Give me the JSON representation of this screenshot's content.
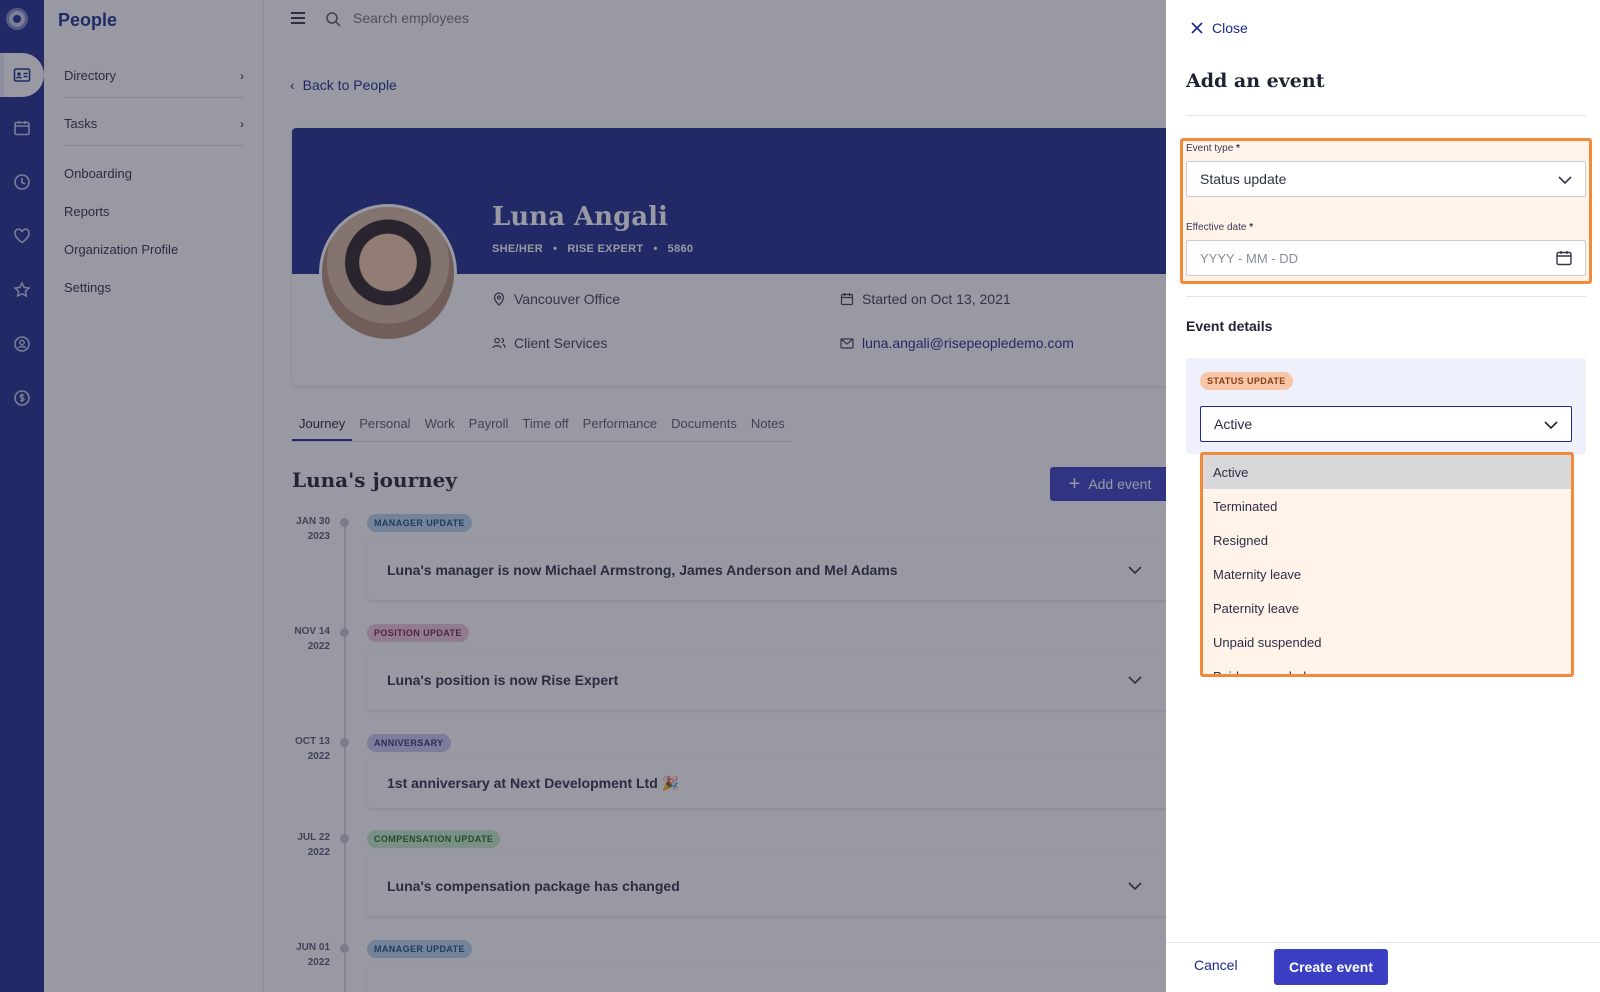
{
  "app": {
    "section_title": "People"
  },
  "sidebar": {
    "items": [
      {
        "label": "Directory"
      },
      {
        "label": "Tasks"
      },
      {
        "label": "Onboarding"
      },
      {
        "label": "Reports"
      },
      {
        "label": "Organization Profile"
      },
      {
        "label": "Settings"
      }
    ]
  },
  "search": {
    "placeholder": "Search employees"
  },
  "back_link": "Back to People",
  "profile": {
    "name": "Luna Angali",
    "pronouns": "SHE/HER",
    "role": "RISE EXPERT",
    "employee_id": "5860",
    "sep": "•",
    "office": "Vancouver Office",
    "team": "Client Services",
    "started": "Started on Oct 13, 2021",
    "email": "luna.angali@risepeopledemo.com"
  },
  "tabs": [
    "Journey",
    "Personal",
    "Work",
    "Payroll",
    "Time off",
    "Performance",
    "Documents",
    "Notes"
  ],
  "journey": {
    "title": "Luna's journey",
    "add_event_label": "Add event",
    "events": [
      {
        "month_day": "JAN 30",
        "year": "2023",
        "badge": "MANAGER UPDATE",
        "badge_color": "#b9d5f0",
        "badge_text_color": "#1f4c7a",
        "text": "Luna's manager is now Michael Armstrong, James Anderson and Mel Adams"
      },
      {
        "month_day": "NOV 14",
        "year": "2022",
        "badge": "POSITION UPDATE",
        "badge_color": "#f0c6dc",
        "badge_text_color": "#7a1f4c",
        "text": "Luna's position is now Rise Expert"
      },
      {
        "month_day": "OCT 13",
        "year": "2022",
        "badge": "ANNIVERSARY",
        "badge_color": "#c9c9f2",
        "badge_text_color": "#2e2e7a",
        "text": "1st anniversary at Next Development Ltd 🎉"
      },
      {
        "month_day": "JUL 22",
        "year": "2022",
        "badge": "COMPENSATION UPDATE",
        "badge_color": "#c6ecc9",
        "badge_text_color": "#1f6a28",
        "text": "Luna's compensation package has changed"
      },
      {
        "month_day": "JUN 01",
        "year": "2022",
        "badge": "MANAGER UPDATE",
        "badge_color": "#b9d5f0",
        "badge_text_color": "#1f4c7a",
        "text": ""
      }
    ]
  },
  "drawer": {
    "close_label": "Close",
    "title": "Add an event",
    "event_type_label": "Event type",
    "required_mark": "*",
    "event_type_value": "Status update",
    "effective_date_label": "Effective date",
    "effective_date_placeholder": "YYYY - MM - DD",
    "details_title": "Event details",
    "status_badge": "STATUS UPDATE",
    "status_value": "Active",
    "status_options": [
      "Active",
      "Terminated",
      "Resigned",
      "Maternity leave",
      "Paternity leave",
      "Unpaid suspended",
      "Paid suspended"
    ],
    "cancel_label": "Cancel",
    "create_label": "Create event"
  },
  "colors": {
    "brand": "#1b2a8c",
    "accent_button": "#3b3fc4",
    "highlight": "#f28a3a"
  }
}
